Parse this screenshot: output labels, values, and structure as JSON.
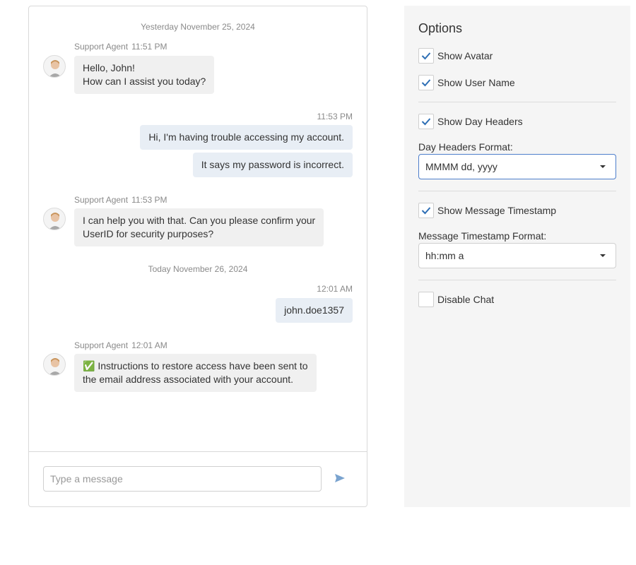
{
  "chat": {
    "agent_name": "Support Agent",
    "day_headers": [
      "Yesterday November 25, 2024",
      "Today November 26, 2024"
    ],
    "messages": [
      {
        "author": "Support Agent",
        "time": "11:51 PM",
        "lines": [
          "Hello, John!",
          "How can I assist you today?"
        ]
      },
      {
        "author": "user",
        "time": "11:53 PM",
        "lines": [
          "Hi, I'm having trouble accessing my account."
        ]
      },
      {
        "author": "user",
        "time": "",
        "lines": [
          "It says my password is incorrect."
        ]
      },
      {
        "author": "Support Agent",
        "time": "11:53 PM",
        "lines": [
          "I can help you with that. Can you please confirm your",
          "UserID for security purposes?"
        ]
      },
      {
        "author": "user",
        "time": "12:01 AM",
        "lines": [
          "john.doe1357"
        ]
      },
      {
        "author": "Support Agent",
        "time": "12:01 AM",
        "lines": [
          "✅ Instructions to restore access have been sent to",
          "the email address associated with your account."
        ]
      }
    ],
    "input_placeholder": "Type a message",
    "send_icon": "send-icon"
  },
  "options": {
    "title": "Options",
    "show_avatar": {
      "label": "Show Avatar",
      "checked": true
    },
    "show_user_name": {
      "label": "Show User Name",
      "checked": true
    },
    "show_day_headers": {
      "label": "Show Day Headers",
      "checked": true
    },
    "day_headers_format": {
      "label": "Day Headers Format:",
      "value": "MMMM dd, yyyy"
    },
    "show_message_timestamp": {
      "label": "Show Message Timestamp",
      "checked": true
    },
    "message_timestamp_format": {
      "label": "Message Timestamp Format:",
      "value": "hh:mm a"
    },
    "disable_chat": {
      "label": "Disable Chat",
      "checked": false
    }
  },
  "colors": {
    "check": "#2e6fb5",
    "send": "#7aa3cf",
    "focus_border": "#4d7ecb"
  }
}
